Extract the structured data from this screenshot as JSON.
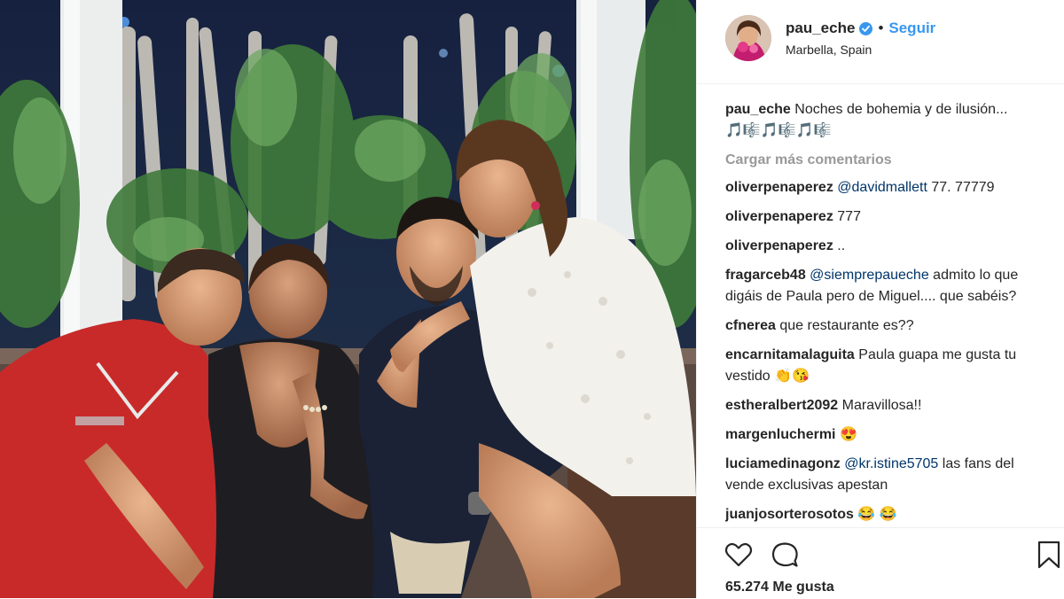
{
  "post": {
    "username": "pau_eche",
    "separator": "•",
    "follow_label": "Seguir",
    "location": "Marbella, Spain",
    "caption_user": "pau_eche",
    "caption_text": "Noches de bohemia y de ilusión... 🎵🎼🎵🎼🎵🎼",
    "load_more_label": "Cargar más comentarios",
    "likes_text": "65.274 Me gusta"
  },
  "comments": [
    {
      "user": "oliverpenaperez",
      "mention": "@davidmallett",
      "text": " 77. 77779"
    },
    {
      "user": "oliverpenaperez",
      "mention": "",
      "text": "777"
    },
    {
      "user": "oliverpenaperez",
      "mention": "",
      "text": ".."
    },
    {
      "user": "fragarceb48",
      "mention": "@siemprepaueche",
      "text": " admito lo que digáis de Paula pero de Miguel.... que sabéis?"
    },
    {
      "user": "cfnerea",
      "mention": "",
      "text": "que restaurante es??"
    },
    {
      "user": "encarnitamalaguita",
      "mention": "",
      "text": "Paula guapa me gusta tu vestido 👏😘"
    },
    {
      "user": "estheralbert2092",
      "mention": "",
      "text": "Maravillosa!!"
    },
    {
      "user": "margenluchermi",
      "mention": "",
      "text": "😍"
    },
    {
      "user": "luciamedinagonz",
      "mention": "@kr.istine5705",
      "text": " las fans del vende exclusivas apestan"
    },
    {
      "user": "juanjosorterosotos",
      "mention": "",
      "text": "😂 😂"
    }
  ],
  "icons": {
    "verified": "verified-badge-icon",
    "like": "heart-icon",
    "comment": "comment-bubble-icon",
    "save": "bookmark-icon"
  },
  "colors": {
    "link_blue": "#3897f0",
    "mention_blue": "#003569",
    "muted_gray": "#999999",
    "border": "#efefef"
  }
}
